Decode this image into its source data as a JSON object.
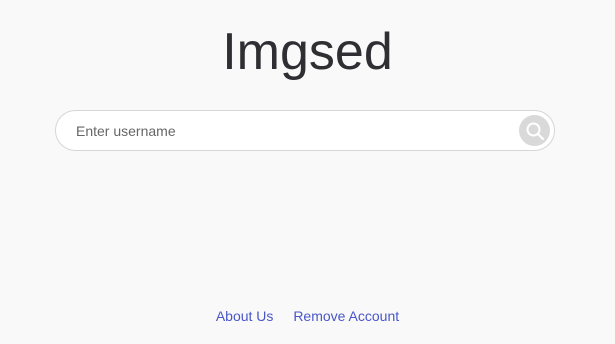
{
  "app": {
    "logo_text": "Imgsed"
  },
  "search": {
    "placeholder": "Enter username",
    "value": "",
    "button_icon": "search-icon"
  },
  "footer": {
    "links": [
      {
        "label": "About Us"
      },
      {
        "label": "Remove Account"
      }
    ]
  },
  "colors": {
    "background": "#f9f9f9",
    "logo": "#2e2e33",
    "link": "#4a56c8",
    "search_button": "#d9d9d9"
  }
}
